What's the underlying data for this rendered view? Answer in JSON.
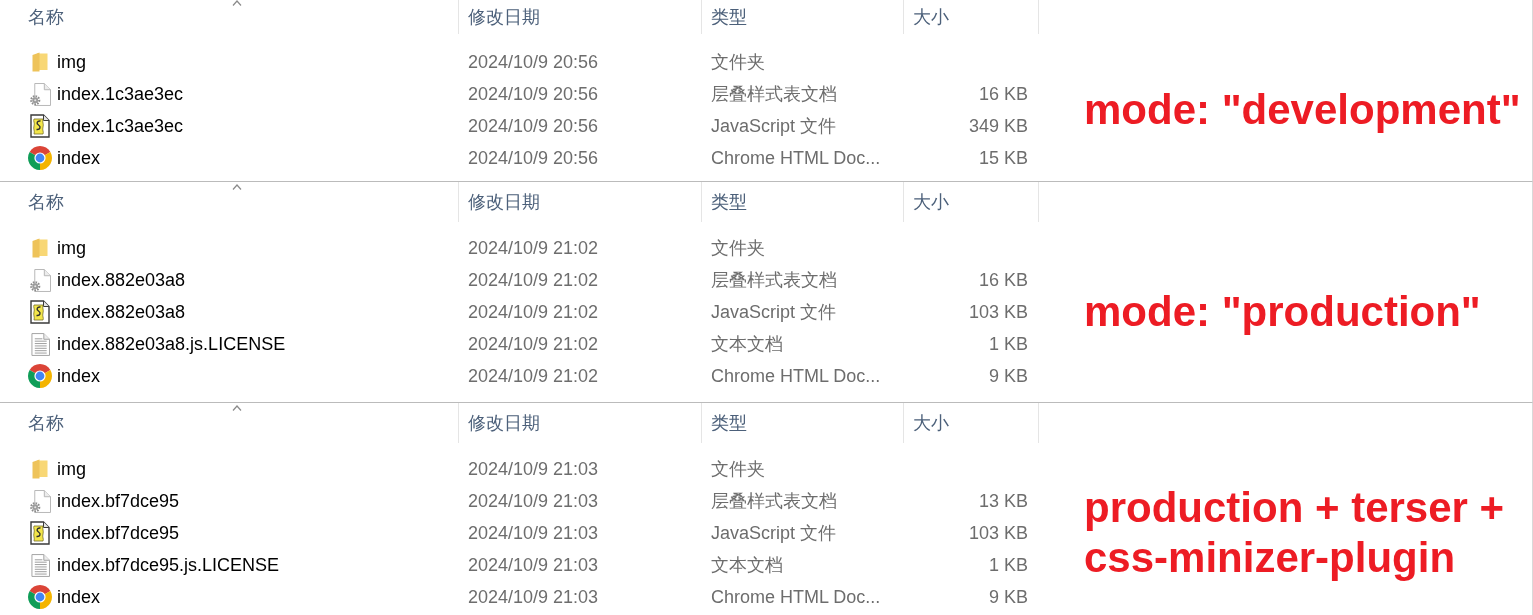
{
  "panels": [
    {
      "columns": [
        {
          "label": "名称",
          "sorted": true
        },
        {
          "label": "修改日期",
          "sorted": false
        },
        {
          "label": "类型",
          "sorted": false
        },
        {
          "label": "大小",
          "sorted": false
        }
      ],
      "files": [
        {
          "kind": "folder",
          "name": "img",
          "modified": "2024/10/9 20:56",
          "type": "文件夹"
        },
        {
          "kind": "css",
          "name": "index.1c3ae3ec",
          "modified": "2024/10/9 20:56",
          "type": "层叠样式表文档",
          "size": "16 KB"
        },
        {
          "kind": "js",
          "name": "index.1c3ae3ec",
          "modified": "2024/10/9 20:56",
          "type": "JavaScript 文件",
          "size": "349 KB"
        },
        {
          "kind": "html",
          "name": "index",
          "modified": "2024/10/9 20:56",
          "type": "Chrome HTML Doc...",
          "size": "15 KB"
        }
      ],
      "annotation": [
        "mode: \"development\""
      ]
    },
    {
      "columns": [
        {
          "label": "名称",
          "sorted": true
        },
        {
          "label": "修改日期",
          "sorted": false
        },
        {
          "label": "类型",
          "sorted": false
        },
        {
          "label": "大小",
          "sorted": false
        }
      ],
      "files": [
        {
          "kind": "folder",
          "name": "img",
          "modified": "2024/10/9 21:02",
          "type": "文件夹"
        },
        {
          "kind": "css",
          "name": "index.882e03a8",
          "modified": "2024/10/9 21:02",
          "type": "层叠样式表文档",
          "size": "16 KB"
        },
        {
          "kind": "js",
          "name": "index.882e03a8",
          "modified": "2024/10/9 21:02",
          "type": "JavaScript 文件",
          "size": "103 KB"
        },
        {
          "kind": "text",
          "name": "index.882e03a8.js.LICENSE",
          "modified": "2024/10/9 21:02",
          "type": "文本文档",
          "size": "1 KB"
        },
        {
          "kind": "html",
          "name": "index",
          "modified": "2024/10/9 21:02",
          "type": "Chrome HTML Doc...",
          "size": "9 KB"
        }
      ],
      "annotation": [
        "mode: \"production\""
      ]
    },
    {
      "columns": [
        {
          "label": "名称",
          "sorted": true
        },
        {
          "label": "修改日期",
          "sorted": false
        },
        {
          "label": "类型",
          "sorted": false
        },
        {
          "label": "大小",
          "sorted": false
        }
      ],
      "files": [
        {
          "kind": "folder",
          "name": "img",
          "modified": "2024/10/9 21:03",
          "type": "文件夹"
        },
        {
          "kind": "css",
          "name": "index.bf7dce95",
          "modified": "2024/10/9 21:03",
          "type": "层叠样式表文档",
          "size": "13 KB"
        },
        {
          "kind": "js",
          "name": "index.bf7dce95",
          "modified": "2024/10/9 21:03",
          "type": "JavaScript 文件",
          "size": "103 KB"
        },
        {
          "kind": "text",
          "name": "index.bf7dce95.js.LICENSE",
          "modified": "2024/10/9 21:03",
          "type": "文本文档",
          "size": "1 KB"
        },
        {
          "kind": "html",
          "name": "index",
          "modified": "2024/10/9 21:03",
          "type": "Chrome HTML Doc...",
          "size": "9 KB"
        }
      ],
      "annotation": [
        "production + terser +",
        "css-minizer-plugin"
      ]
    }
  ]
}
